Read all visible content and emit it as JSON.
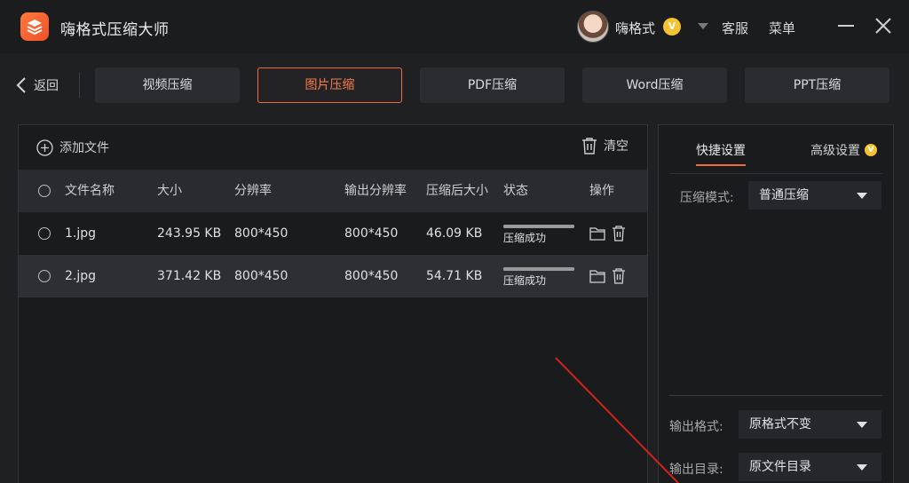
{
  "app": {
    "title": "嗨格式压缩大师"
  },
  "user": {
    "name": "嗨格式",
    "vip_badge": "V"
  },
  "header": {
    "service": "客服",
    "menu": "菜单"
  },
  "nav": {
    "back": "返回"
  },
  "tabs": [
    {
      "label": "视频压缩"
    },
    {
      "label": "图片压缩",
      "active": true
    },
    {
      "label": "PDF压缩"
    },
    {
      "label": "Word压缩"
    },
    {
      "label": "PPT压缩"
    }
  ],
  "toolbar": {
    "add_file": "添加文件",
    "clear": "清空"
  },
  "table": {
    "headers": {
      "name": "文件名称",
      "size": "大小",
      "resolution": "分辨率",
      "output_resolution": "输出分辨率",
      "compressed_size": "压缩后大小",
      "status": "状态",
      "actions": "操作"
    },
    "rows": [
      {
        "name": "1.jpg",
        "size": "243.95 KB",
        "resolution": "800*450",
        "output_resolution": "800*450",
        "compressed_size": "46.09 KB",
        "status": "压缩成功",
        "progress": 1.0
      },
      {
        "name": "2.jpg",
        "size": "371.42 KB",
        "resolution": "800*450",
        "output_resolution": "800*450",
        "compressed_size": "54.71 KB",
        "status": "压缩成功",
        "progress": 1.0
      }
    ]
  },
  "settings": {
    "tab_quick": "快捷设置",
    "tab_advanced": "高级设置",
    "advanced_badge": "V",
    "mode_label": "压缩模式:",
    "mode_value": "普通压缩",
    "format_label": "输出格式:",
    "format_value": "原格式不变",
    "dir_label": "输出目录:",
    "dir_value": "原文件目录"
  },
  "colors": {
    "accent": "#f06a3c",
    "vip": "#f5c230",
    "annotation": "#d0231b"
  }
}
